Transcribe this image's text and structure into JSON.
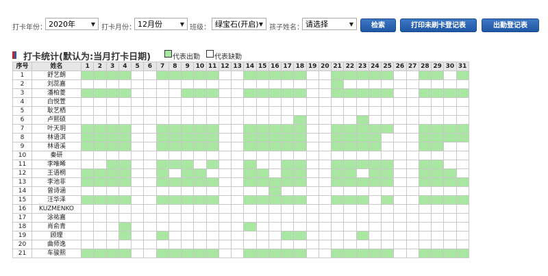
{
  "filters": {
    "year_label": "打卡年份：",
    "year_value": "2020年",
    "month_label": "打卡月份：",
    "month_value": "12月份",
    "class_label": "班级：",
    "class_value": "绿宝石(开启)",
    "child_label": "孩子姓名：",
    "child_value": "请选择",
    "arrow_glyph": "▼"
  },
  "buttons": {
    "search": "检索",
    "print_missing": "打印未刷卡登记表",
    "attendance_register": "出勤登记表"
  },
  "heading": {
    "title": "打卡统计(默认为:当月打卡日期)",
    "legend_present": "代表出勤",
    "legend_absent": "代表缺勤",
    "marker_colors": [
      "#c0262a",
      "#2f5d9e"
    ]
  },
  "table": {
    "seq_header": "序号",
    "name_header": "姓名",
    "days": [
      "1",
      "2",
      "3",
      "4",
      "5",
      "6",
      "7",
      "8",
      "9",
      "10",
      "11",
      "12",
      "13",
      "14",
      "15",
      "16",
      "17",
      "18",
      "19",
      "20",
      "21",
      "22",
      "23",
      "24",
      "25",
      "26",
      "27",
      "28",
      "29",
      "30",
      "31"
    ],
    "present_color": "#a8e6a1",
    "rows": [
      {
        "seq": "1",
        "name": "舒艺朗",
        "present": [
          1,
          2,
          3,
          4,
          7,
          8,
          9,
          10,
          11,
          14,
          15,
          16,
          17,
          18,
          21,
          22,
          23,
          24,
          25,
          28,
          29,
          31
        ]
      },
      {
        "seq": "2",
        "name": "刘蕊嘉",
        "present": [
          21
        ]
      },
      {
        "seq": "3",
        "name": "潘柏菱",
        "present": [
          1,
          2,
          3,
          4,
          9,
          10,
          11,
          14,
          15,
          16,
          17,
          18,
          21,
          22,
          23,
          24,
          25,
          28,
          29,
          30,
          31
        ]
      },
      {
        "seq": "4",
        "name": "白悦萱",
        "present": []
      },
      {
        "seq": "5",
        "name": "耿艺栖",
        "present": []
      },
      {
        "seq": "6",
        "name": "卢熙硕",
        "present": [
          18,
          23
        ]
      },
      {
        "seq": "7",
        "name": "叶天玥",
        "present": [
          1,
          2,
          3,
          4,
          7,
          8,
          9,
          10,
          11,
          14,
          15,
          16,
          17,
          18,
          21,
          22,
          23,
          24,
          25,
          28,
          29,
          30,
          31
        ]
      },
      {
        "seq": "8",
        "name": "林语淇",
        "present": [
          1,
          2,
          3,
          4,
          7,
          8,
          9,
          10,
          11,
          14,
          15,
          16,
          17,
          18,
          21,
          22,
          23,
          24,
          28,
          29,
          30,
          31
        ]
      },
      {
        "seq": "9",
        "name": "林语溪",
        "present": [
          1,
          2,
          3,
          4,
          7,
          8,
          9,
          10,
          11,
          14,
          15,
          16,
          17,
          18,
          21,
          22,
          23,
          24,
          28,
          29
        ]
      },
      {
        "seq": "10",
        "name": "秦研",
        "present": []
      },
      {
        "seq": "11",
        "name": "李唯晞",
        "present": [
          3,
          4,
          7,
          8,
          9,
          11,
          14,
          17,
          18,
          21,
          22,
          23,
          24,
          25,
          28,
          29
        ]
      },
      {
        "seq": "12",
        "name": "王语桐",
        "present": [
          1,
          2,
          3,
          4,
          7,
          9,
          10,
          14,
          15,
          17,
          18,
          21,
          22,
          24,
          25,
          28,
          29,
          30
        ]
      },
      {
        "seq": "13",
        "name": "李池非",
        "present": [
          1,
          2,
          3,
          4,
          7,
          8,
          9,
          10,
          11,
          14,
          15,
          16,
          17,
          18,
          21,
          22,
          23,
          24,
          25,
          28,
          29,
          30,
          31
        ]
      },
      {
        "seq": "14",
        "name": "曾诗涵",
        "present": [
          16
        ]
      },
      {
        "seq": "15",
        "name": "汪华泽",
        "present": [
          1,
          2,
          3,
          4,
          7,
          8,
          9,
          10,
          11,
          14,
          15,
          16,
          17,
          18,
          21,
          22,
          23,
          25,
          28,
          29,
          30,
          31
        ]
      },
      {
        "seq": "16",
        "name": "KUZMENKO",
        "present": []
      },
      {
        "seq": "17",
        "name": "涂祐嘉",
        "present": []
      },
      {
        "seq": "18",
        "name": "肖俞青",
        "present": [
          4,
          14
        ]
      },
      {
        "seq": "19",
        "name": "顾理",
        "present": [
          4,
          7,
          17,
          18,
          23
        ]
      },
      {
        "seq": "20",
        "name": "曲师逸",
        "present": []
      },
      {
        "seq": "21",
        "name": "车骏熙",
        "present": [
          1,
          2,
          3,
          4,
          7,
          8,
          9,
          10,
          11,
          14,
          15,
          16,
          17,
          18,
          21,
          22,
          23,
          24,
          25,
          28,
          29,
          30,
          31
        ]
      }
    ]
  }
}
